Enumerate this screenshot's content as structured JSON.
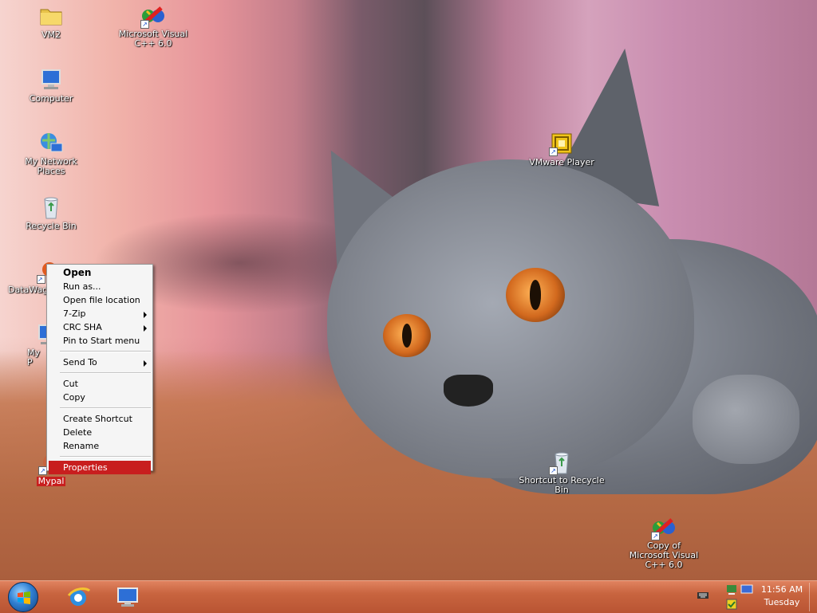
{
  "desktop_icons": [
    {
      "id": "vm2",
      "label": "VM2",
      "icon": "folder-icon",
      "shortcut": false,
      "selected": false
    },
    {
      "id": "msvc",
      "label": "Microsoft Visual C++ 6.0",
      "icon": "visual-cpp-icon",
      "shortcut": true,
      "selected": false
    },
    {
      "id": "computer",
      "label": "Computer",
      "icon": "computer-icon",
      "shortcut": false,
      "selected": false
    },
    {
      "id": "network",
      "label": "My Network Places",
      "icon": "network-places-icon",
      "shortcut": false,
      "selected": false
    },
    {
      "id": "recycle",
      "label": "Recycle Bin",
      "icon": "recycle-bin-icon",
      "shortcut": false,
      "selected": false
    },
    {
      "id": "datawag",
      "label": "DataWag",
      "icon": "datawag-icon",
      "shortcut": true,
      "selected": false
    },
    {
      "id": "myp",
      "label": "My P",
      "icon": "computer-icon",
      "shortcut": true,
      "selected": false
    },
    {
      "id": "mypal",
      "label": "Mypal",
      "icon": "mypal-icon",
      "shortcut": true,
      "selected": true
    },
    {
      "id": "vmware",
      "label": "VMware Player",
      "icon": "vmware-icon",
      "shortcut": true,
      "selected": false
    },
    {
      "id": "recycle-shortcut",
      "label": "Shortcut to Recycle Bin",
      "icon": "recycle-bin-icon",
      "shortcut": true,
      "selected": false
    },
    {
      "id": "msvc-copy",
      "label": "Copy of Microsoft Visual C++ 6.0",
      "icon": "visual-cpp-icon",
      "shortcut": true,
      "selected": false
    }
  ],
  "context_menu": {
    "items": [
      {
        "label": "Open",
        "bold": true,
        "submenu": false
      },
      {
        "label": "Run as...",
        "submenu": false
      },
      {
        "label": "Open file location",
        "submenu": false
      },
      {
        "label": "7-Zip",
        "submenu": true
      },
      {
        "label": "CRC SHA",
        "submenu": true
      },
      {
        "label": "Pin to Start menu",
        "submenu": false
      },
      {
        "separator": true
      },
      {
        "label": "Send To",
        "submenu": true
      },
      {
        "separator": true
      },
      {
        "label": "Cut",
        "submenu": false
      },
      {
        "label": "Copy",
        "submenu": false
      },
      {
        "separator": true
      },
      {
        "label": "Create Shortcut",
        "submenu": false
      },
      {
        "label": "Delete",
        "submenu": false
      },
      {
        "label": "Rename",
        "submenu": false
      },
      {
        "separator": true
      },
      {
        "label": "Properties",
        "submenu": false,
        "highlighted": true
      }
    ]
  },
  "taskbar": {
    "pinned": [
      {
        "name": "internet-explorer-icon"
      },
      {
        "name": "remote-desktop-icon"
      }
    ],
    "tray": {
      "icons": [
        "keyboard-icon",
        "network-tray-icon",
        "monitor-tray-icon",
        "security-tray-icon"
      ]
    },
    "clock": {
      "time": "11:56 AM",
      "day": "Tuesday"
    }
  },
  "colors": {
    "selection": "#c81e1e",
    "taskbar": "#c8643f"
  }
}
